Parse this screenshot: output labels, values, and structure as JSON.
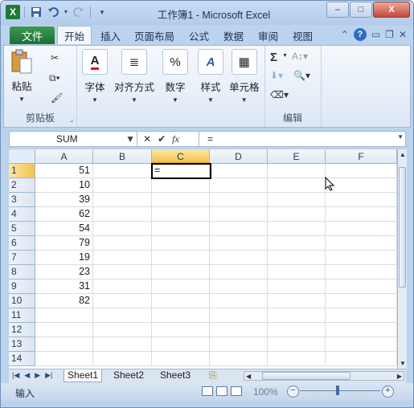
{
  "window": {
    "title": "工作簿1 - Microsoft Excel",
    "app_icon": "X",
    "minimize": "–",
    "maximize": "□",
    "close": "X"
  },
  "ribbon_tabs": {
    "file": "文件",
    "items": [
      "开始",
      "插入",
      "页面布局",
      "公式",
      "数据",
      "审阅",
      "视图"
    ],
    "active": "开始"
  },
  "ribbon": {
    "paste": "粘贴",
    "clipboard_group": "剪贴板",
    "font": "字体",
    "alignment": "对齐方式",
    "number": "数字",
    "styles": "样式",
    "cells": "单元格",
    "editing_group": "编辑",
    "font_icon": "A",
    "number_icon": "%",
    "styles_icon": "A",
    "sum_icon": "Σ"
  },
  "formula_bar": {
    "name_box": "SUM",
    "cancel": "✕",
    "enter": "✔",
    "fx": "fx",
    "content": "="
  },
  "grid": {
    "columns": [
      "A",
      "B",
      "C",
      "D",
      "E",
      "F"
    ],
    "selected_column": "C",
    "rows": [
      "1",
      "2",
      "3",
      "4",
      "5",
      "6",
      "7",
      "8",
      "9",
      "10",
      "11",
      "12",
      "13",
      "14"
    ],
    "selected_row": "1",
    "column_a_values": [
      "51",
      "10",
      "39",
      "62",
      "54",
      "79",
      "19",
      "23",
      "31",
      "82"
    ],
    "active_cell_content": "="
  },
  "sheets": {
    "tabs": [
      "Sheet1",
      "Sheet2",
      "Sheet3"
    ],
    "active": "Sheet1"
  },
  "status_bar": {
    "mode": "输入",
    "zoom": "100%",
    "zoom_minus": "−",
    "zoom_plus": "+"
  }
}
